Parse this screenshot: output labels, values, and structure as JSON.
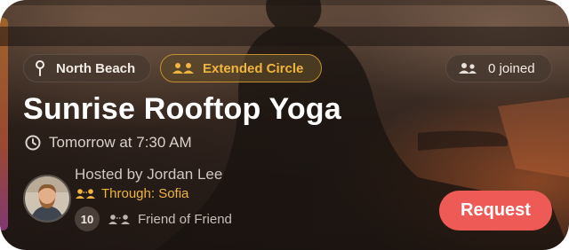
{
  "event": {
    "location": "North Beach",
    "circle": "Extended Circle",
    "joined": "0 joined",
    "title": "Sunrise Rooftop Yoga",
    "time": "Tomorrow at 7:30 AM"
  },
  "host": {
    "hosted_by": "Hosted by Jordan Lee",
    "through": "Through: Sofia",
    "mutual_count": "10",
    "relation": "Friend of Friend"
  },
  "actions": {
    "request_label": "Request"
  },
  "colors": {
    "accent_gold": "#f0b53c",
    "request_button": "#ee5a55"
  },
  "icons": [
    "pin-icon",
    "people-icon",
    "clock-icon"
  ]
}
